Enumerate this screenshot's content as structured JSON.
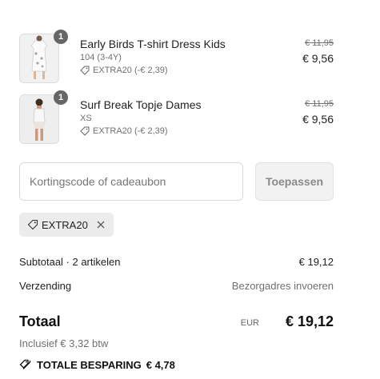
{
  "items": [
    {
      "qty": "1",
      "name": "Early Birds T-shirt Dress Kids",
      "variant": "104 (3-4Y)",
      "discount": "EXTRA20 (-€ 2,39)",
      "old_price": "€ 11,95",
      "new_price": "€ 9,56"
    },
    {
      "qty": "1",
      "name": "Surf Break Topje Dames",
      "variant": "XS",
      "discount": "EXTRA20 (-€ 2,39)",
      "old_price": "€ 11,95",
      "new_price": "€ 9,56"
    }
  ],
  "coupon": {
    "placeholder": "Kortingscode of cadeaubon",
    "apply_label": "Toepassen",
    "applied_code": "EXTRA20"
  },
  "summary": {
    "subtotal_label": "Subtotaal · 2 artikelen",
    "subtotal_value": "€ 19,12",
    "shipping_label": "Verzending",
    "shipping_value": "Bezorgadres invoeren",
    "total_label": "Totaal",
    "total_currency": "EUR",
    "total_value": "€ 19,12",
    "tax_note": "Inclusief € 3,32 btw",
    "savings_label": "TOTALE BESPARING",
    "savings_value": "€ 4,78"
  },
  "icons": {
    "tag": "tag-icon",
    "remove": "close-icon",
    "savings": "double-tag-icon"
  },
  "colors": {
    "muted_text": "#707070",
    "button_bg": "#f2f2f2",
    "chip_bg": "#ececec",
    "badge_bg": "#666666"
  }
}
